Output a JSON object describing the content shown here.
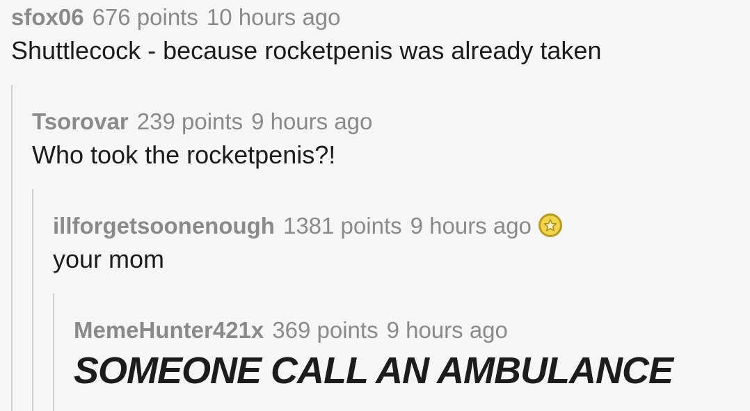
{
  "comments": [
    {
      "author": "sfox06",
      "points": "676 points",
      "time": "10 hours ago",
      "body": "Shuttlecock - because rocketpenis was already taken"
    },
    {
      "author": "Tsorovar",
      "points": "239 points",
      "time": "9 hours ago",
      "body": "Who took the rocketpenis?!"
    },
    {
      "author": "illforgetsoonenough",
      "points": "1381 points",
      "time": "9 hours ago",
      "body": "your mom",
      "award_icon": "gold-award-icon"
    },
    {
      "author": "MemeHunter421x",
      "points": "369 points",
      "time": "9 hours ago",
      "body": "SOMEONE CALL AN AMBULANCE"
    }
  ],
  "colors": {
    "background": "#f6f6f6",
    "meta_text": "#8a8a8a",
    "body_text": "#1c1c1c",
    "thread_line": "#cfcfcf",
    "award_gold": "#f2d44a"
  }
}
